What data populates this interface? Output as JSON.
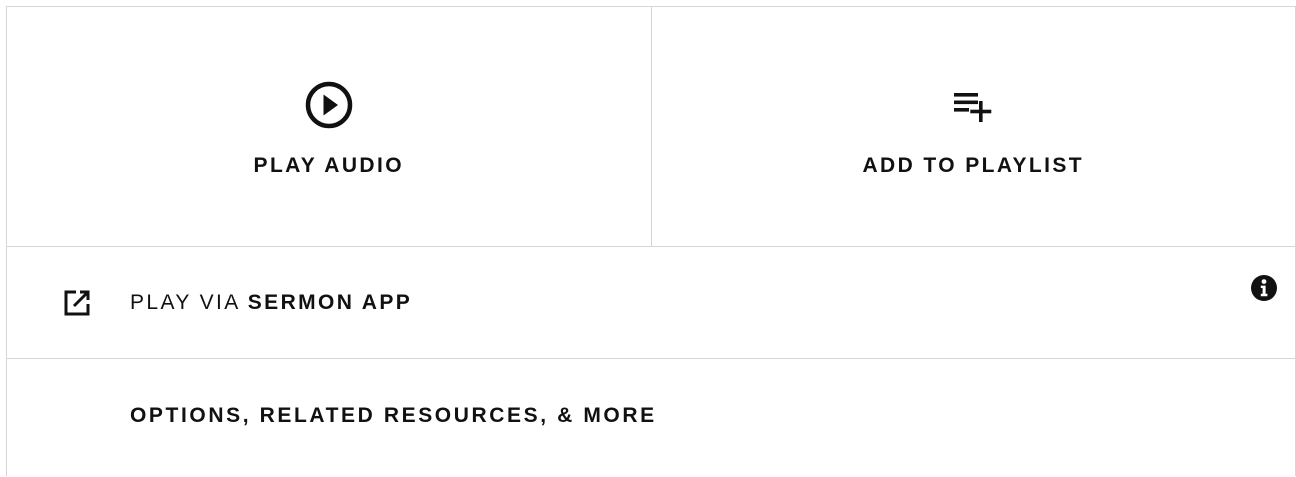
{
  "actions": {
    "play_audio": {
      "label": "PLAY AUDIO",
      "icon": "play-circle-icon"
    },
    "add_to_playlist": {
      "label": "ADD TO PLAYLIST",
      "icon": "playlist-add-icon"
    }
  },
  "sermon_app": {
    "prefix": "PLAY VIA",
    "app_name": "SERMON APP",
    "icon": "external-link-icon",
    "info_icon": "info-icon"
  },
  "more": {
    "label": "OPTIONS, RELATED RESOURCES, & MORE"
  },
  "colors": {
    "text": "#111111",
    "border": "#d6d6d6",
    "background": "#ffffff"
  }
}
